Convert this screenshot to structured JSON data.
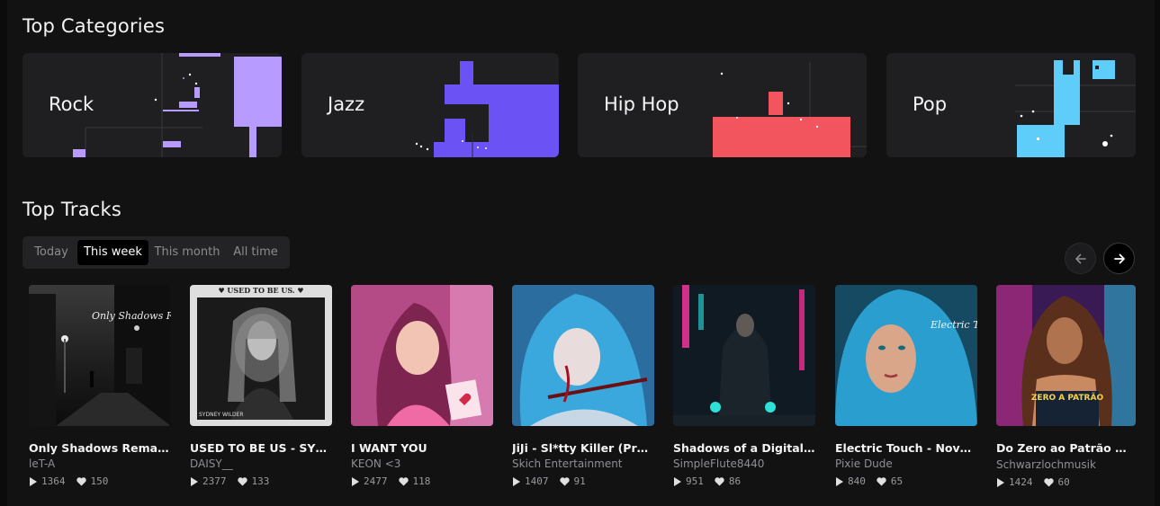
{
  "sections": {
    "categories_title": "Top Categories",
    "tracks_title": "Top Tracks"
  },
  "categories": [
    {
      "label": "Rock",
      "color": "#b89bff"
    },
    {
      "label": "Jazz",
      "color": "#6b52f5"
    },
    {
      "label": "Hip Hop",
      "color": "#f3555e"
    },
    {
      "label": "Pop",
      "color": "#5fcdfa"
    }
  ],
  "tabs": [
    {
      "label": "Today",
      "active": false
    },
    {
      "label": "This week",
      "active": true
    },
    {
      "label": "This month",
      "active": false
    },
    {
      "label": "All time",
      "active": false
    }
  ],
  "nav": {
    "prev_icon": "arrow-left-icon",
    "next_icon": "arrow-right-icon"
  },
  "tracks": [
    {
      "title": "Only Shadows Remain - J...",
      "artist": "leT-A",
      "plays": "1364",
      "likes": "150",
      "cover_text": "Only Shadows Remain"
    },
    {
      "title": "USED TO BE US - SYDNE...",
      "artist": "DAISY__",
      "plays": "2377",
      "likes": "133",
      "cover_text": "♥ USED TO BE US. ♥",
      "cover_caption": "SYDNEY WILDER"
    },
    {
      "title": "I WANT YOU",
      "artist": "KEON <3",
      "plays": "2477",
      "likes": "118"
    },
    {
      "title": "JiJi - Sl*tty Killer (Prod. ...",
      "artist": "Skich Entertainment",
      "plays": "1407",
      "likes": "91"
    },
    {
      "title": "Shadows of a Digital Fro...",
      "artist": "SimpleFlute8440",
      "plays": "951",
      "likes": "86"
    },
    {
      "title": "Electric Touch - Nova Luxe",
      "artist": "Pixie Dude",
      "plays": "840",
      "likes": "65",
      "cover_text": "Electric Touch"
    },
    {
      "title": "Do Zero ao Patrão 🪽 (P...",
      "artist": "Schwarzlochmusik",
      "plays": "1424",
      "likes": "60",
      "cover_text": "ZERO A PATRÃO"
    }
  ]
}
